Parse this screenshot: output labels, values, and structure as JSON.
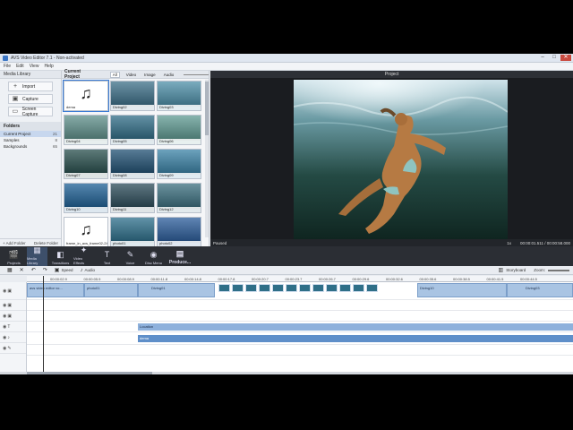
{
  "window": {
    "title": "AVS Video Editor 7.1 - Non-activated",
    "min": "–",
    "max": "□",
    "close": "✕"
  },
  "menu": [
    "File",
    "Edit",
    "View",
    "Help"
  ],
  "media_library": {
    "header": "Media Library",
    "buttons": [
      {
        "label": "Import",
        "icon": "plus-icon"
      },
      {
        "label": "Capture",
        "icon": "camera-icon"
      },
      {
        "label": "Screen Capture",
        "icon": "monitor-icon"
      }
    ],
    "folders_header": "Folders",
    "folders": [
      {
        "name": "Current Project",
        "count": "21"
      },
      {
        "name": "Samples",
        "count": "8"
      },
      {
        "name": "Backgrounds",
        "count": "65"
      }
    ],
    "add_folder": "+ Add Folder",
    "delete_folder": "Delete Folder"
  },
  "media_panel": {
    "title": "Current Project",
    "tabs": [
      "All",
      "Video",
      "Image",
      "Audio"
    ],
    "active_tab": "All",
    "items": [
      {
        "label": "dema",
        "type": "audio"
      },
      {
        "label": "Diving02",
        "type": "video",
        "color": "#3c6f88"
      },
      {
        "label": "Diving03",
        "type": "video",
        "color": "#4d8fa8"
      },
      {
        "label": "Diving04",
        "type": "video",
        "color": "#5e8f8a"
      },
      {
        "label": "Diving05",
        "type": "video",
        "color": "#2f6c86"
      },
      {
        "label": "Diving06",
        "type": "video",
        "color": "#5f9a92"
      },
      {
        "label": "Diving07",
        "type": "video",
        "color": "#274e4c"
      },
      {
        "label": "Diving08",
        "type": "video",
        "color": "#1f4f72"
      },
      {
        "label": "Diving09",
        "type": "video",
        "color": "#3a82a6"
      },
      {
        "label": "Diving10",
        "type": "video",
        "color": "#1d5f94"
      },
      {
        "label": "Diving11",
        "type": "video",
        "color": "#2a4a58"
      },
      {
        "label": "Diving12",
        "type": "video",
        "color": "#3a6e7e"
      },
      {
        "label": "frame_in_avs_frame02-24",
        "type": "audio"
      },
      {
        "label": "photo01",
        "type": "video",
        "color": "#2c6e8a"
      },
      {
        "label": "photo02",
        "type": "video",
        "color": "#2a5c9a"
      }
    ]
  },
  "preview": {
    "header": "Project",
    "status": "Paused",
    "speed": "1x",
    "time": "00:00:01.511 / 00:00:58.000"
  },
  "toolbar": [
    {
      "label": "Projects",
      "icon": "clapper-icon"
    },
    {
      "label": "Media Library",
      "icon": "film-icon",
      "active": true
    },
    {
      "label": "Transitions",
      "icon": "transitions-icon"
    },
    {
      "label": "Video Effects",
      "icon": "star-icon"
    },
    {
      "label": "Text",
      "icon": "text-icon"
    },
    {
      "label": "Voice",
      "icon": "mic-icon"
    },
    {
      "label": "Disc Menu",
      "icon": "disc-icon"
    },
    {
      "label": "Produce...",
      "icon": "produce-icon"
    }
  ],
  "timeline_toolbar": {
    "speed": "Speed",
    "audio": "Audio",
    "storyboard": "Storyboard",
    "zoom": "Zoom:"
  },
  "ruler": [
    "00:00:02.9",
    "00:00:05.9",
    "00:00:08.9",
    "00:00:11.8",
    "00:00:14.8",
    "00:00:17.8",
    "00:00:20.7",
    "00:00:23.7",
    "00:00:26.7",
    "00:00:29.6",
    "00:00:32.6",
    "00:00:35.6",
    "00:00:38.5",
    "00:00:41.5",
    "00:00:44.5"
  ],
  "timeline": {
    "video_clips": [
      {
        "label": "avs video editor vo..."
      },
      {
        "label": "photo01"
      },
      {
        "label": "Diving01"
      },
      {
        "label": "Diving10"
      },
      {
        "label": "Diving03"
      }
    ],
    "text_clip": "Location",
    "audio_clip": "dema"
  }
}
